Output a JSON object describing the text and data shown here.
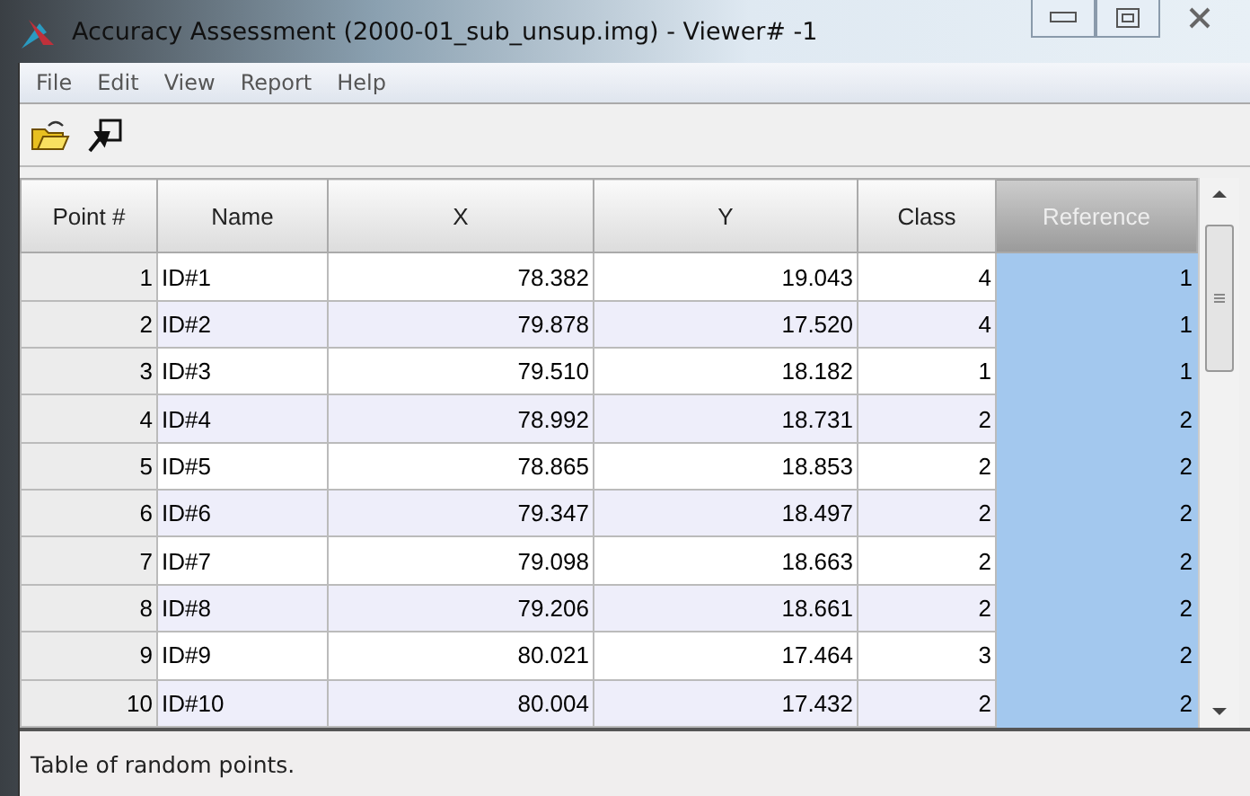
{
  "window": {
    "title": "Accuracy Assessment (2000-01_sub_unsup.img) - Viewer# -1"
  },
  "menu": [
    "File",
    "Edit",
    "View",
    "Report",
    "Help"
  ],
  "table": {
    "columns": [
      {
        "label": "Point #",
        "selected": false
      },
      {
        "label": "Name",
        "selected": false
      },
      {
        "label": "X",
        "selected": false
      },
      {
        "label": "Y",
        "selected": false
      },
      {
        "label": "Class",
        "selected": false
      },
      {
        "label": "Reference",
        "selected": true
      }
    ],
    "rows": [
      [
        "1",
        "ID#1",
        "78.382",
        "19.043",
        "4",
        "1"
      ],
      [
        "2",
        "ID#2",
        "79.878",
        "17.520",
        "4",
        "1"
      ],
      [
        "3",
        "ID#3",
        "79.510",
        "18.182",
        "1",
        "1"
      ],
      [
        "4",
        "ID#4",
        "78.992",
        "18.731",
        "2",
        "2"
      ],
      [
        "5",
        "ID#5",
        "78.865",
        "18.853",
        "2",
        "2"
      ],
      [
        "6",
        "ID#6",
        "79.347",
        "18.497",
        "2",
        "2"
      ],
      [
        "7",
        "ID#7",
        "79.098",
        "18.663",
        "2",
        "2"
      ],
      [
        "8",
        "ID#8",
        "79.206",
        "18.661",
        "2",
        "2"
      ],
      [
        "9",
        "ID#9",
        "80.021",
        "17.464",
        "3",
        "2"
      ],
      [
        "10",
        "ID#10",
        "80.004",
        "17.432",
        "2",
        "2"
      ]
    ]
  },
  "status_bar": "Table of random points."
}
